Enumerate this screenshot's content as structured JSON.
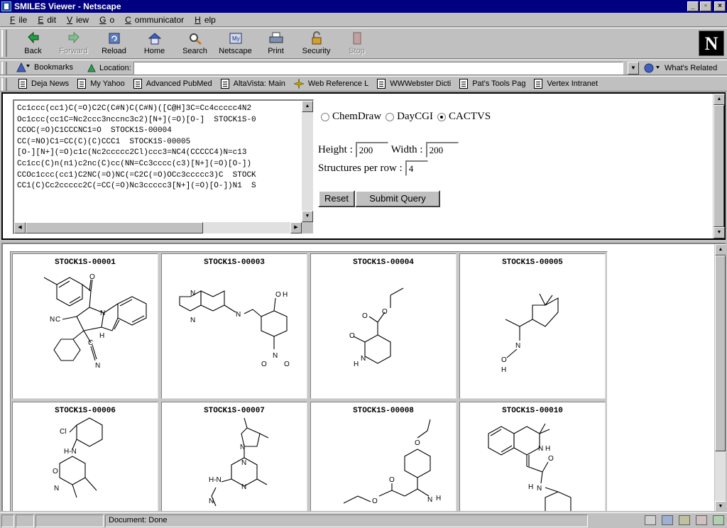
{
  "window": {
    "title": "SMILES Viewer - Netscape"
  },
  "menu": [
    {
      "ul": "F",
      "rest": "ile"
    },
    {
      "ul": "E",
      "rest": "dit"
    },
    {
      "ul": "V",
      "rest": "iew"
    },
    {
      "ul": "G",
      "rest": "o"
    },
    {
      "ul": "C",
      "rest": "ommunicator"
    },
    {
      "ul": "H",
      "rest": "elp"
    }
  ],
  "toolbar": {
    "back": "Back",
    "forward": "Forward",
    "reload": "Reload",
    "home": "Home",
    "search": "Search",
    "netscape": "Netscape",
    "print": "Print",
    "security": "Security",
    "stop": "Stop"
  },
  "location": {
    "bookmarks": "Bookmarks",
    "label": "Location:",
    "url": "",
    "whats_related": "What's Related"
  },
  "personal": [
    "Deja News",
    "My Yahoo",
    "Advanced PubMed",
    "AltaVista: Main",
    "Web Reference L",
    "WWWebster Dicti",
    "Pat's Tools Pag",
    "Vertex Intranet"
  ],
  "smiles_lines": [
    "Cc1ccc(cc1)C(=O)C2C(C#N)C(C#N)([C@H]3C=Cc4ccccc4N2",
    "Oc1ccc(cc1C=Nc2ccc3nccnc3c2)[N+](=O)[O-]  STOCK1S-0",
    "CCOC(=O)C1CCCNC1=O  STOCK1S-00004",
    "CC(=NO)C1=CC(C)(C)CCC1  STOCK1S-00005",
    "[O-][N+](=O)c1c(Nc2ccccc2Cl)ccc3=NC4(CCCCC4)N=c13",
    "Cc1cc(C)n(n1)c2nc(C)cc(NN=Cc3cccc(c3)[N+](=O)[O-])",
    "CCOc1ccc(cc1)C2NC(=O)NC(=C2C(=O)OCc3ccccc3)C  STOCK",
    "CC1(C)Cc2ccccc2C(=CC(=O)Nc3ccccc3[N+](=O)[O-])N1  S"
  ],
  "form": {
    "renderers": [
      "ChemDraw",
      "DayCGI",
      "CACTVS"
    ],
    "selected_renderer": "CACTVS",
    "height_label": "Height :",
    "height_value": "200",
    "width_label": "Width :",
    "width_value": "200",
    "spr_label": "Structures per row :",
    "spr_value": "4",
    "reset": "Reset",
    "submit": "Submit Query"
  },
  "structures": [
    "STOCK1S-00001",
    "STOCK1S-00003",
    "STOCK1S-00004",
    "STOCK1S-00005",
    "STOCK1S-00006",
    "STOCK1S-00007",
    "STOCK1S-00008",
    "STOCK1S-00010"
  ],
  "status": {
    "text": "Document: Done"
  }
}
